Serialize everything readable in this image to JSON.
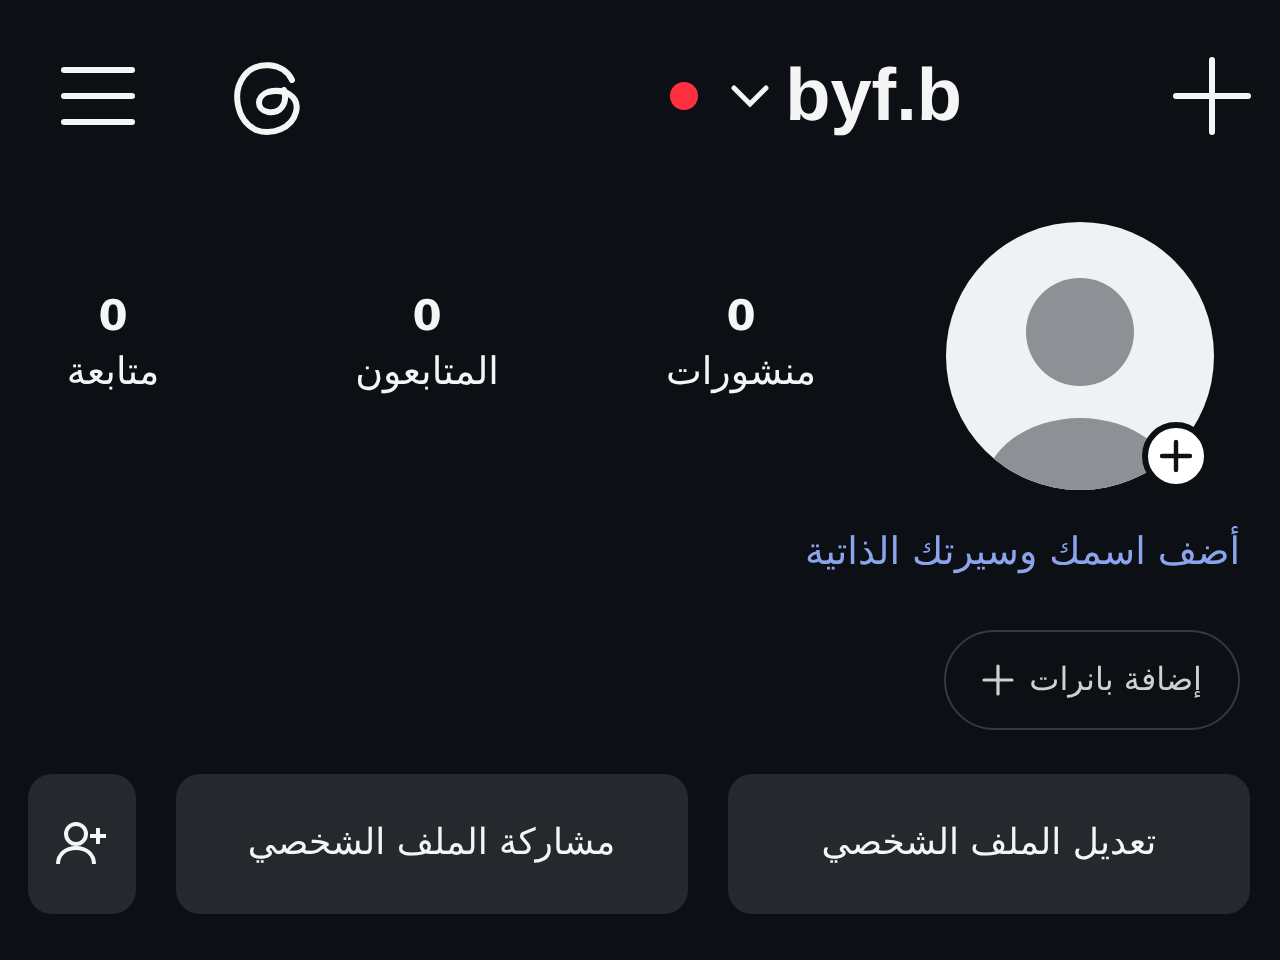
{
  "top_bar": {
    "has_notification": true,
    "username": "byf.b"
  },
  "profile": {
    "stats": [
      {
        "count": "0",
        "label": "منشورات"
      },
      {
        "count": "0",
        "label": "المتابعون"
      },
      {
        "count": "0",
        "label": "متابعة"
      }
    ],
    "bio_prompt": "أضف اسمك وسيرتك الذاتية",
    "banner_button": {
      "label": "إضافة بانرات"
    }
  },
  "buttons": [
    {
      "kind": "text",
      "label": "تعديل الملف الشخصي"
    },
    {
      "kind": "text",
      "label": "مشاركة الملف الشخصي"
    },
    {
      "kind": "icon"
    }
  ]
}
